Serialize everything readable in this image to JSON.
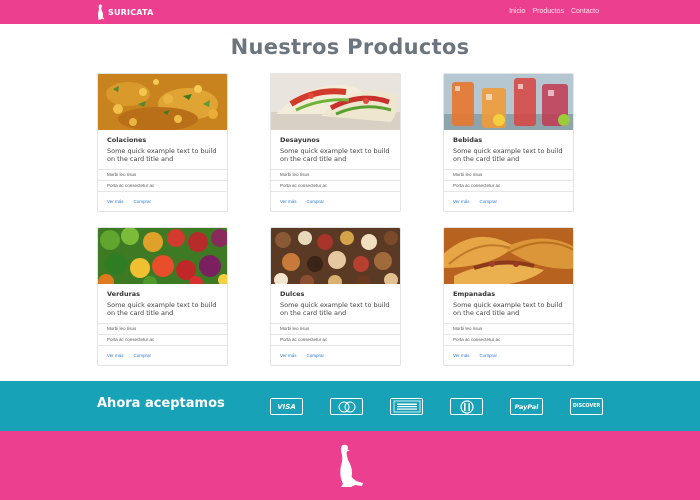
{
  "navbar": {
    "brand": "SURICATA",
    "links": [
      "Inicio",
      "Productos",
      "Contacto"
    ]
  },
  "page_title": "Nuestros Productos",
  "cards": [
    {
      "title": "Colaciones",
      "text": "Some quick example text to build on the card title and",
      "item": "Morbi leo risus",
      "item2": "Porta ac consectetur ac",
      "link1": "Ver más",
      "link2": "Comprar",
      "image": "chickpea-curry-photo"
    },
    {
      "title": "Desayunos",
      "text": "Some quick example text to build on the card title and",
      "item": "Morbi leo risus",
      "item2": "Porta ac consectetur ac",
      "link1": "Ver más",
      "link2": "Comprar",
      "image": "wrap-sandwich-photo"
    },
    {
      "title": "Bebidas",
      "text": "Some quick example text to build on the card title and",
      "item": "Morbi leo risus",
      "item2": "Porta ac consectetur ac",
      "link1": "Ver más",
      "link2": "Comprar",
      "image": "iced-drinks-photo"
    },
    {
      "title": "Verduras",
      "text": "Some quick example text to build on the card title and",
      "item": "Morbi leo risus",
      "item2": "Porta ac consectetur ac",
      "link1": "Ver más",
      "link2": "Comprar",
      "image": "vegetables-photo"
    },
    {
      "title": "Dulces",
      "text": "Some quick example text to build on the card title and",
      "item": "Morbi leo risus",
      "item2": "Porta ac consectetur ac",
      "link1": "Ver más",
      "link2": "Comprar",
      "image": "sweets-photo"
    },
    {
      "title": "Empanadas",
      "text": "Some quick example text to build on the card title and",
      "item": "Morbi leo risus",
      "item2": "Porta ac consectetur ac",
      "link1": "Ver más",
      "link2": "Comprar",
      "image": "empanadas-photo"
    }
  ],
  "payments": {
    "title": "Ahora aceptamos",
    "cards": [
      {
        "name": "visa-icon",
        "label": "VISA"
      },
      {
        "name": "mastercard-icon",
        "label": ""
      },
      {
        "name": "american-express-icon",
        "label": ""
      },
      {
        "name": "diners-club-icon",
        "label": ""
      },
      {
        "name": "paypal-icon",
        "label": "PayPal"
      },
      {
        "name": "discover-icon",
        "label": "DISCOVER"
      }
    ]
  },
  "colors": {
    "primary_pink": "#ec3f8f",
    "teal": "#17a2b8",
    "title_gray": "#6c757d",
    "link_blue": "#2f7bd6"
  }
}
